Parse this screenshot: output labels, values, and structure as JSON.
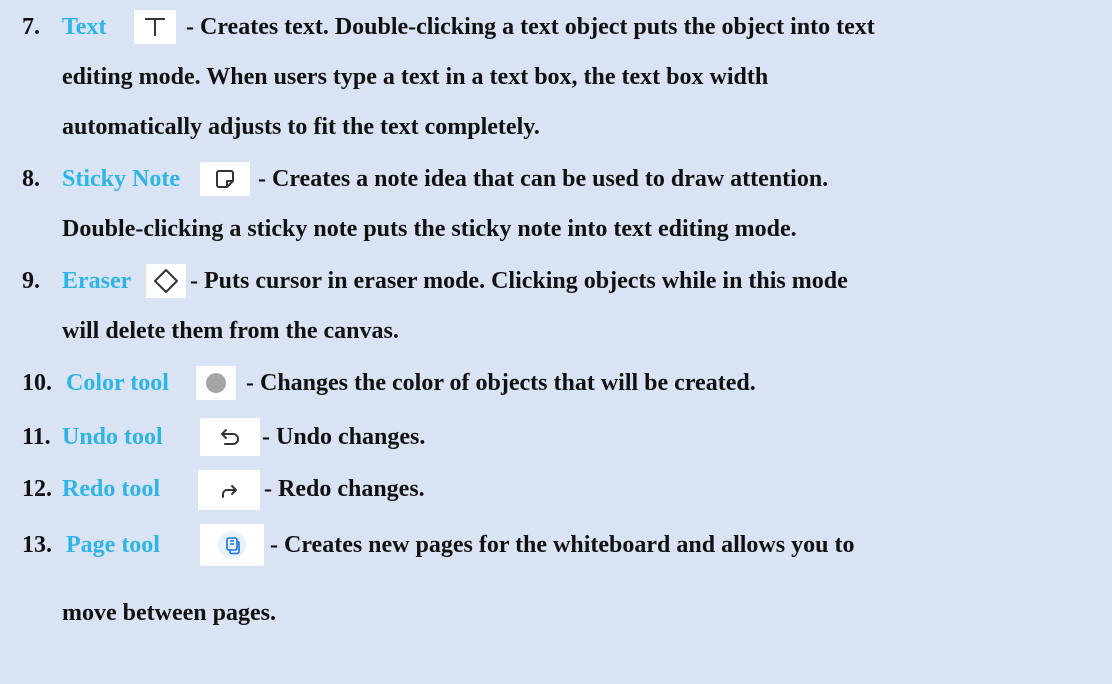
{
  "items": [
    {
      "number": "7.",
      "title": "Text",
      "icon": "text-icon",
      "lines": [
        "- Creates text. Double-clicking a text object puts the object into text",
        "editing mode. When users type a text in a text box, the text box width",
        "automatically adjusts to fit the text completely."
      ]
    },
    {
      "number": "8.",
      "title": "Sticky Note",
      "icon": "sticky-note-icon",
      "lines": [
        "- Creates a note idea that can be used to draw attention.",
        "Double-clicking a sticky note puts the sticky note into text editing mode."
      ]
    },
    {
      "number": "9.",
      "title": "Eraser",
      "icon": "eraser-icon",
      "lines": [
        "- Puts cursor in eraser mode. Clicking objects while in this mode",
        "will delete them from the canvas."
      ]
    },
    {
      "number": "10.",
      "title": "Color tool",
      "icon": "color-dot-icon",
      "lines": [
        "- Changes the color of objects that will be created."
      ]
    },
    {
      "number": "11.",
      "title": "Undo tool",
      "icon": "undo-icon",
      "lines": [
        "- Undo changes."
      ]
    },
    {
      "number": "12.",
      "title": "Redo tool",
      "icon": "redo-icon",
      "lines": [
        "- Redo changes."
      ]
    },
    {
      "number": "13.",
      "title": "Page tool",
      "icon": "page-icon",
      "lines": [
        "- Creates new pages for the whiteboard and allows you to",
        "move between pages."
      ]
    }
  ],
  "colors": {
    "background": "#dae3f3",
    "title": "#2eb5e8",
    "text": "#111111",
    "icon_box": "#ffffff",
    "color_dot": "#a6a6a6",
    "page_icon_bg": "#e8f2fd",
    "page_icon_stroke": "#1a73e8"
  }
}
